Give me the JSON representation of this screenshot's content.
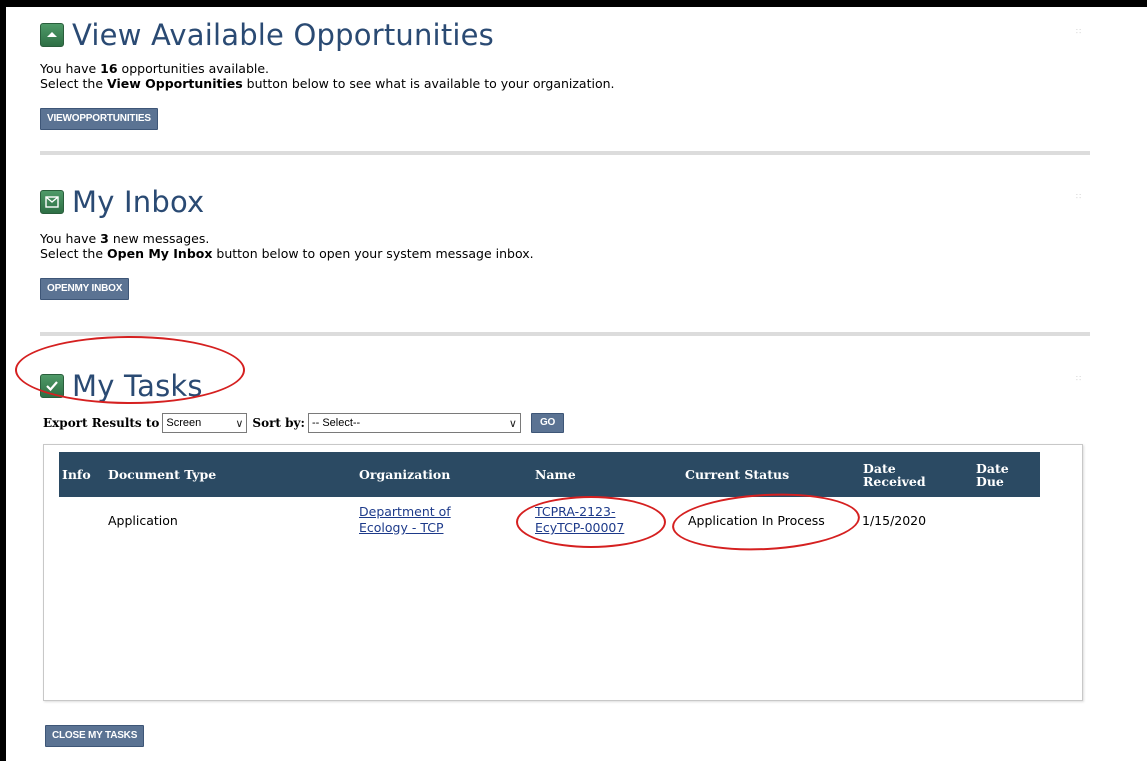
{
  "opportunities": {
    "title": "View Available Opportunities",
    "line1_pre": "You have ",
    "count": "16",
    "line1_post": " opportunities available.",
    "line2_pre": "Select the ",
    "line2_bold": "View Opportunities",
    "line2_post": " button below to see what is available to your organization.",
    "button": "VIEWOPPORTUNITIES"
  },
  "inbox": {
    "title": "My Inbox",
    "line1_pre": "You have ",
    "count": "3",
    "line1_post": " new messages.",
    "line2_pre": "Select the ",
    "line2_bold": "Open My Inbox",
    "line2_post": " button below to open your system message inbox.",
    "button": "OPENMY INBOX"
  },
  "tasks": {
    "title": "My Tasks",
    "export_label": "Export Results to",
    "export_value": "Screen",
    "sort_label": "Sort by:",
    "sort_value": "-- Select--",
    "go_label": "GO",
    "columns": {
      "info": "Info",
      "document_type": "Document Type",
      "organization": "Organization",
      "name": "Name",
      "current_status": "Current Status",
      "date_received": "Date Received",
      "date_due": "Date Due"
    },
    "rows": [
      {
        "document_type": "Application",
        "organization": "Department of Ecology - TCP",
        "name": "TCPRA-2123-EcyTCP-00007",
        "current_status": "Application In Process",
        "date_received": "1/15/2020",
        "date_due": ""
      }
    ],
    "close_button": "CLOSE MY TASKS"
  },
  "colors": {
    "header_bg": "#2b4a63",
    "button_bg": "#5b7393",
    "title_color": "#2a4a73",
    "annotation_red": "#d52020"
  }
}
